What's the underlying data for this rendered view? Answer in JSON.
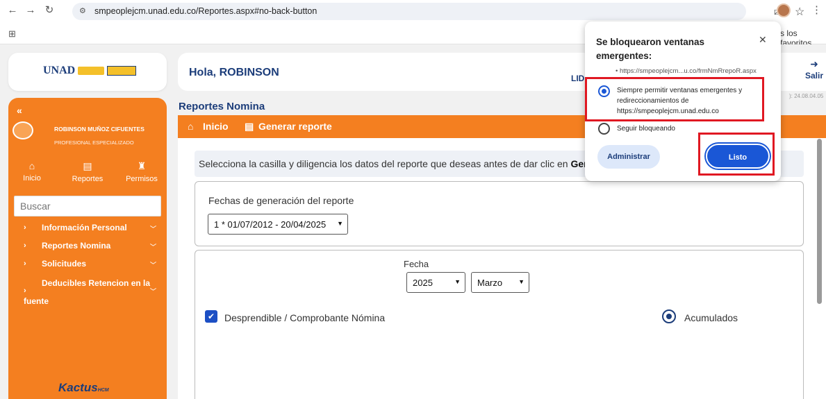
{
  "browser": {
    "url": "smpeoplejcm.unad.edu.co/Reportes.aspx#no-back-button",
    "favorites_text": "s los favoritos",
    "icons": [
      "back-icon",
      "forward-icon",
      "reload-icon",
      "site-settings-icon",
      "popup-blocked-icon",
      "bookmark-star-icon",
      "menu-icon",
      "apps-icon"
    ]
  },
  "header": {
    "greeting": "Hola, ROBINSON",
    "lid_text": "LID",
    "salir_label": "Salir",
    "version_text": "): 24.08.04.05"
  },
  "sidebar": {
    "user_name": "ROBINSON MUÑOZ CIFUENTES",
    "user_role": "PROFESIONAL ESPECIALIZADO",
    "nav": [
      {
        "label": "Inicio",
        "icon": "home-icon"
      },
      {
        "label": "Reportes",
        "icon": "file-icon"
      },
      {
        "label": "Permisos",
        "icon": "permissions-icon"
      }
    ],
    "search_placeholder": "Buscar",
    "menu": [
      {
        "label": "Información Personal"
      },
      {
        "label": "Reportes Nomina"
      },
      {
        "label": "Solicitudes"
      },
      {
        "label_line1": "Deducibles Retencion en la",
        "label_line2": "fuente"
      }
    ],
    "footer_logo": "Kactus",
    "footer_logo_suffix": "HCM"
  },
  "main": {
    "section_title": "Reportes Nomina",
    "breadcrumb_home": "Inicio",
    "breadcrumb_current": "Generar reporte",
    "instruction": "Selecciona la casilla y diligencia los datos del reporte que deseas antes de dar clic en ",
    "instruction_bold": "Gene",
    "fechas_label": "Fechas de generación del reporte",
    "fechas_value": "1 * 01/07/2012 - 20/04/2025",
    "fecha_label": "Fecha",
    "year_value": "2025",
    "month_value": "Marzo",
    "desprendible_label": "Desprendible / Comprobante Nómina",
    "acumulados_label": "Acumulados"
  },
  "popup": {
    "title": "Se bloquearon ventanas emergentes:",
    "blocked_url": "• https://smpeoplejcm...u.co/frmNmRrepoR.aspx",
    "allow_label": "Siempre permitir ventanas emergentes y redireccionamientos de https://smpeoplejcm.unad.edu.co",
    "block_label": "Seguir bloqueando",
    "manage_label": "Administrar",
    "done_label": "Listo"
  },
  "colors": {
    "accent_orange": "#f47f20",
    "brand_navy": "#1c3d7a",
    "chrome_blue": "#1a57d6",
    "highlight_red": "#e01822"
  }
}
